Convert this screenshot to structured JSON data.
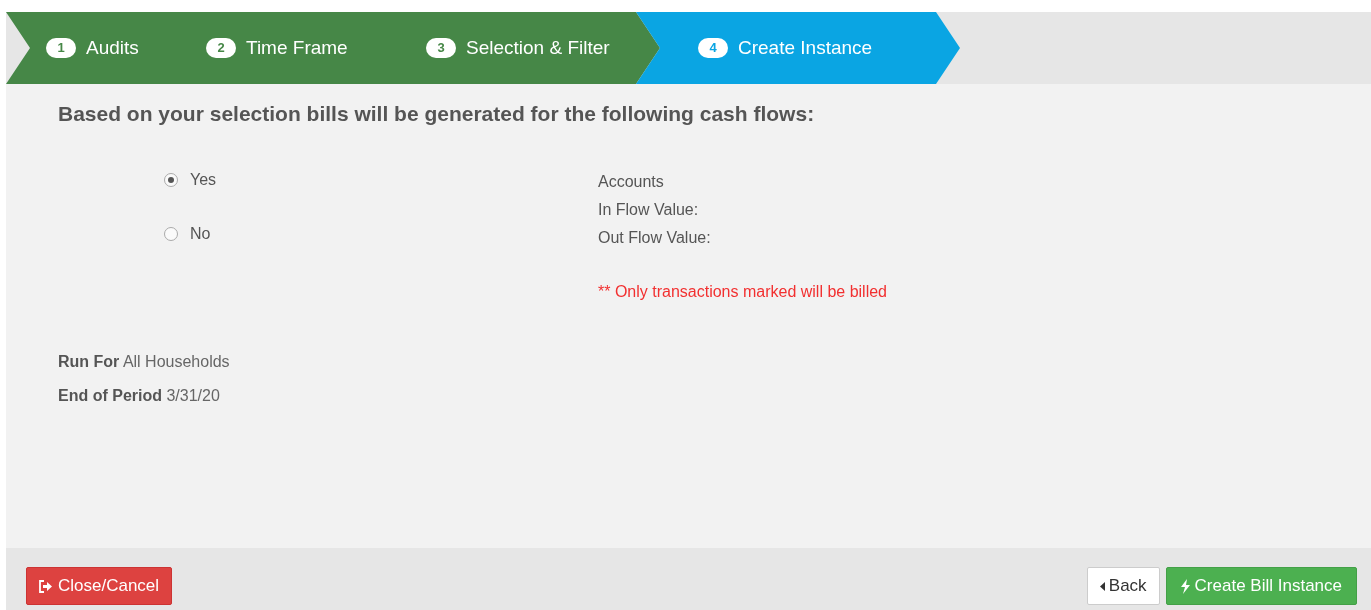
{
  "steps": [
    {
      "number": "1",
      "label": "Audits",
      "selected": false
    },
    {
      "number": "2",
      "label": "Time Frame",
      "selected": false
    },
    {
      "number": "3",
      "label": "Selection & Filter",
      "selected": false
    },
    {
      "number": "4",
      "label": "Create Instance",
      "selected": true
    }
  ],
  "heading": "Based on your selection bills will be generated for the following cash flows:",
  "options": [
    {
      "label": "Yes",
      "selected": true
    },
    {
      "label": "No",
      "selected": false
    }
  ],
  "summary": [
    "Accounts",
    "In Flow Value:",
    "Out Flow Value:"
  ],
  "note": "** Only transactions marked will be billed",
  "details": [
    "**Run For** All Households",
    "**End of Period** 3/31/20"
  ],
  "buttons": {
    "cancel": "Close/Cancel",
    "back": "Back",
    "create": "Create Bill Instance"
  }
}
